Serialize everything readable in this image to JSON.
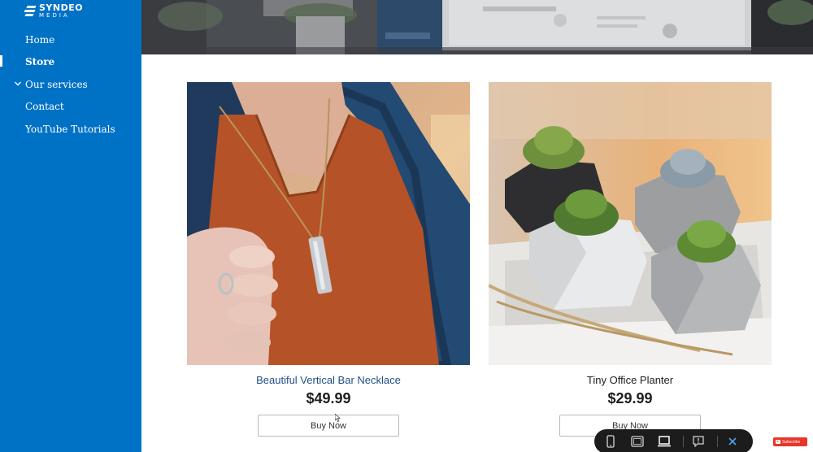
{
  "brand": {
    "line1": "SYNDEO",
    "line2": "MEDIA"
  },
  "nav": {
    "items": [
      {
        "label": "Home"
      },
      {
        "label": "Store"
      },
      {
        "label": "Our services"
      },
      {
        "label": "Contact"
      },
      {
        "label": "YouTube Tutorials"
      }
    ],
    "active": "Store"
  },
  "products": [
    {
      "name": "Beautiful Vertical Bar Necklace",
      "price": "$49.99",
      "button": "Buy Now"
    },
    {
      "name": "Tiny Office Planter",
      "price": "$29.99",
      "button": "Buy Now"
    }
  ],
  "toolbar": {
    "icons": [
      "phone-icon",
      "tablet-icon",
      "laptop-icon",
      "feedback-icon",
      "close-icon"
    ]
  },
  "subscribe": {
    "label": "Subscribe"
  },
  "colors": {
    "sidebar": "#0072c6",
    "product_name_link": "#1f4f8a",
    "toolbar": "#1c1c1c",
    "subscribe": "#e8352b"
  }
}
